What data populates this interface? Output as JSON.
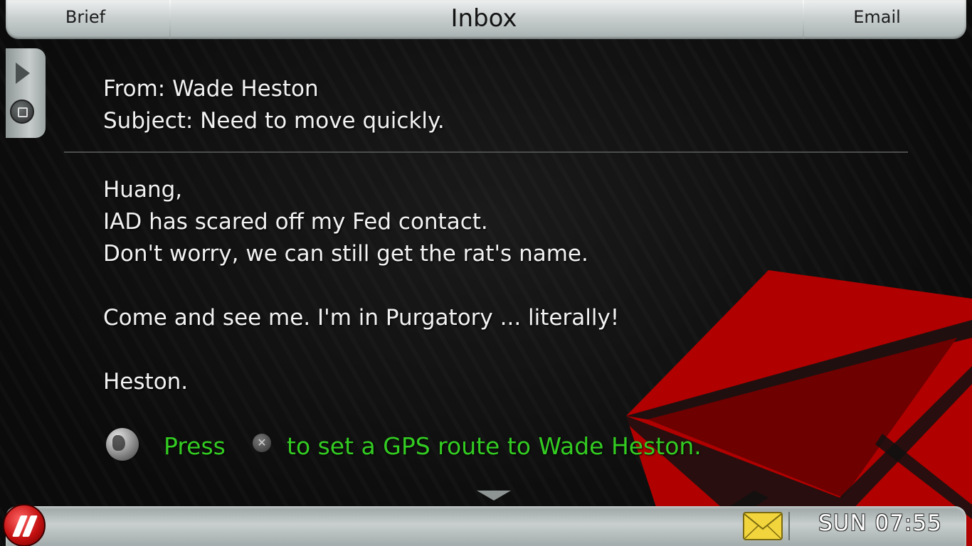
{
  "header": {
    "left_tab": "Brief",
    "title": "Inbox",
    "right_tab": "Email"
  },
  "message": {
    "from": "From: Wade Heston",
    "subject": "Subject: Need to move quickly.",
    "body_lines": [
      "Huang,",
      "IAD has scared off my Fed contact.",
      "Don't worry, we can still get the rat's name.",
      "Come and see me. I'm in Purgatory ... literally!",
      "Heston."
    ]
  },
  "gps_prompt": {
    "press": "Press",
    "button_glyph": "✕",
    "action": "to set a GPS route to Wade Heston."
  },
  "status_bar": {
    "clock": "SUN 07:55"
  },
  "icons": {
    "side_top": "play-icon",
    "side_bottom": "stop-icon",
    "gps": "globe-icon",
    "scroll": "scroll-down-icon",
    "logo": "logo-icon",
    "mail": "mail-icon"
  },
  "colors": {
    "accent_green": "#33cc22",
    "envelope_red": "#c40000",
    "mail_yellow": "#f2d43c"
  }
}
